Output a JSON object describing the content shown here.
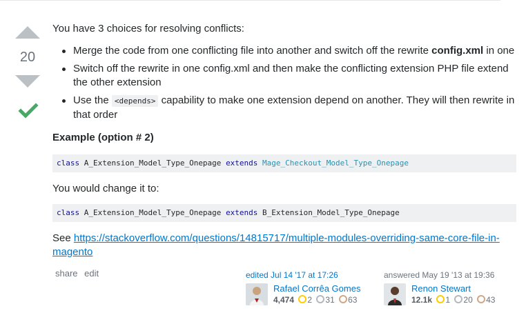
{
  "vote": {
    "count": "20"
  },
  "post": {
    "intro": "You have 3 choices for resolving conflicts:",
    "choices": [
      {
        "a": "Merge the code from one conflicting file into another and switch off the rewrite ",
        "b": "config.xml",
        "c": " in one"
      },
      {
        "a": "Switch off the rewrite in one config.xml and then make the conflicting extension PHP file extend the other extension"
      },
      {
        "a": "Use the ",
        "code": "<depends>",
        "c": " capability to make one extension depend on another. They will then rewrite in that order"
      }
    ],
    "example_heading": "Example (option # 2)",
    "code1": {
      "kw1": "class",
      "name": "A_Extension_Model_Type_Onepage",
      "kw2": "extends",
      "parent": "Mage_Checkout_Model_Type_Onepage"
    },
    "change_text": "You would change it to:",
    "code2": {
      "kw1": "class",
      "name": "A_Extension_Model_Type_Onepage",
      "kw2": "extends",
      "parent": "B_Extension_Model_Type_Onepage"
    },
    "see_prefix": "See ",
    "see_link": "https://stackoverflow.com/questions/14815717/multiple-modules-overriding-same-core-file-in-magento"
  },
  "actions": {
    "share": "share",
    "edit": "edit"
  },
  "editor": {
    "action_time": "edited Jul 14 '17 at 17:26",
    "name": "Rafael Corrêa Gomes",
    "rep": "4,474",
    "gold": "2",
    "silver": "31",
    "bronze": "63"
  },
  "answerer": {
    "action_time": "answered May 19 '13 at 19:36",
    "name": "Renon Stewart",
    "rep": "12.1k",
    "gold": "1",
    "silver": "20",
    "bronze": "43"
  },
  "colors": {
    "link": "#0077cc",
    "accepted": "#48a868",
    "vote_arrow": "#bbc0c4",
    "code_bg": "#eff0f1"
  },
  "icons": {
    "up": "vote-up-arrow-icon",
    "down": "vote-down-arrow-icon",
    "accepted": "checkmark-icon"
  }
}
